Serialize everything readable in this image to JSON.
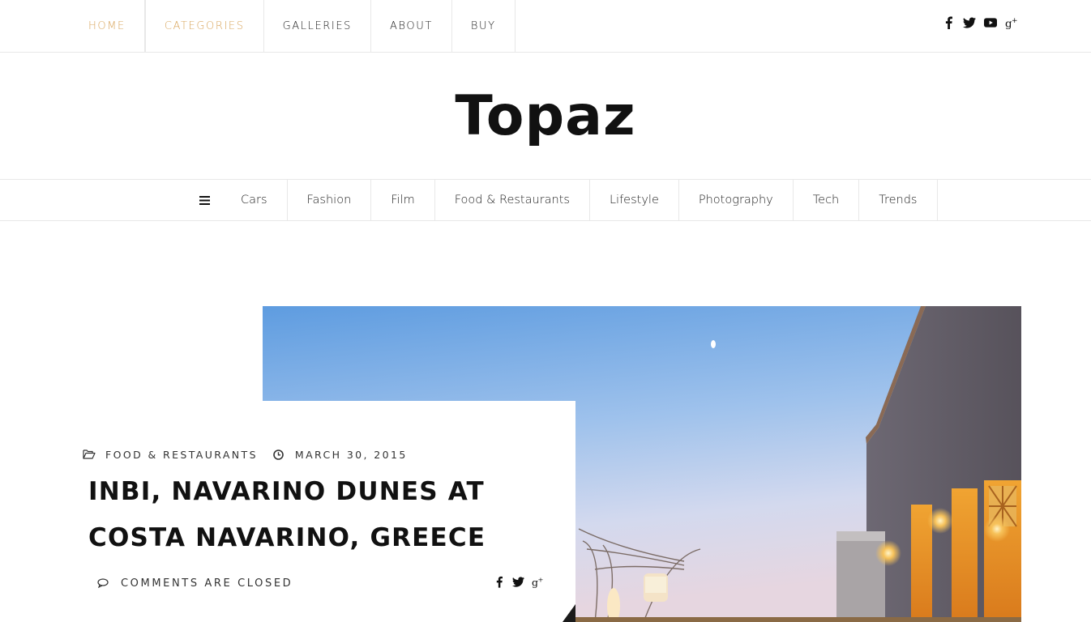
{
  "top_nav": {
    "items": [
      {
        "label": "HOME",
        "active": true
      },
      {
        "label": "CATEGORIES",
        "active": true
      },
      {
        "label": "GALLERIES",
        "active": false
      },
      {
        "label": "ABOUT",
        "active": false
      },
      {
        "label": "BUY",
        "active": false
      }
    ],
    "social_icons": [
      "facebook-icon",
      "twitter-icon",
      "youtube-icon",
      "google-plus-icon"
    ]
  },
  "site": {
    "logo": "Topaz"
  },
  "category_nav": {
    "menu_icon": "hamburger-menu-icon",
    "items": [
      "Cars",
      "Fashion",
      "Film",
      "Food & Restaurants",
      "Lifestyle",
      "Photography",
      "Tech",
      "Trends"
    ]
  },
  "featured_post": {
    "category": "FOOD & RESTAURANTS",
    "date": "MARCH 30, 2015",
    "title_line1": "INBI, NAVARINO DUNES AT",
    "title_line2": "COSTA NAVARINO, GREECE",
    "comments": "COMMENTS ARE CLOSED",
    "category_icon": "folder-open-icon",
    "date_icon": "clock-icon",
    "comments_icon": "comment-icon",
    "share_icons": [
      "facebook-icon",
      "twitter-icon",
      "google-plus-icon"
    ],
    "image_alt": "Restaurant terrace at dusk"
  },
  "colors": {
    "accent": "#d9a55b",
    "text": "#222222",
    "border": "#e8e8e8"
  }
}
